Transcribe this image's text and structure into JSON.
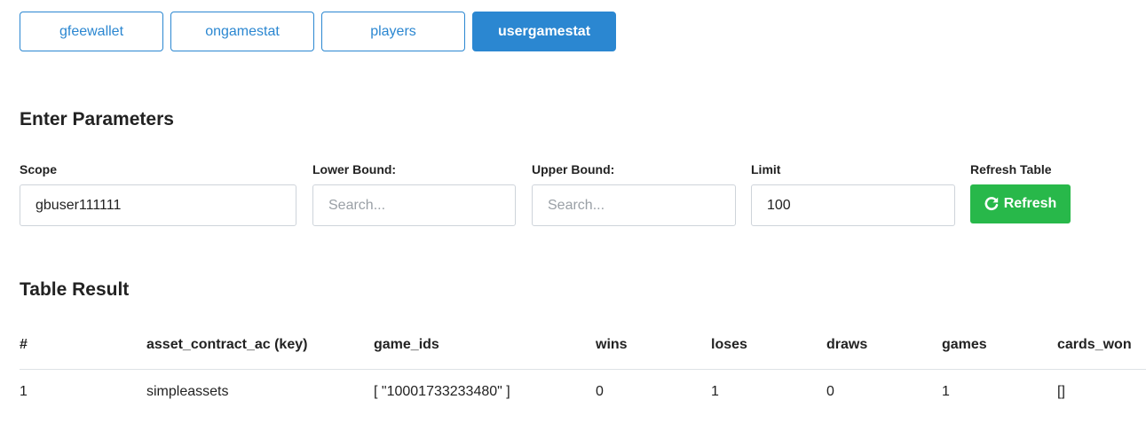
{
  "tabs": [
    {
      "label": "gfeewallet",
      "active": false
    },
    {
      "label": "ongamestat",
      "active": false
    },
    {
      "label": "players",
      "active": false
    },
    {
      "label": "usergamestat",
      "active": true
    }
  ],
  "params": {
    "title": "Enter Parameters",
    "scope": {
      "label": "Scope",
      "value": "gbuser111111"
    },
    "lower": {
      "label": "Lower Bound:",
      "placeholder": "Search..."
    },
    "upper": {
      "label": "Upper Bound:",
      "placeholder": "Search..."
    },
    "limit": {
      "label": "Limit",
      "value": "100"
    },
    "refresh": {
      "label": "Refresh Table",
      "button": "Refresh",
      "icon": "refresh-icon"
    }
  },
  "result": {
    "title": "Table Result",
    "columns": [
      "#",
      "asset_contract_ac (key)",
      "game_ids",
      "wins",
      "loses",
      "draws",
      "games",
      "cards_won"
    ],
    "rows": [
      [
        "1",
        "simpleassets",
        "[ \"10001733233480\" ]",
        "0",
        "1",
        "0",
        "1",
        "[]"
      ]
    ]
  },
  "colors": {
    "primary": "#2b87d1",
    "success": "#28b84a"
  }
}
